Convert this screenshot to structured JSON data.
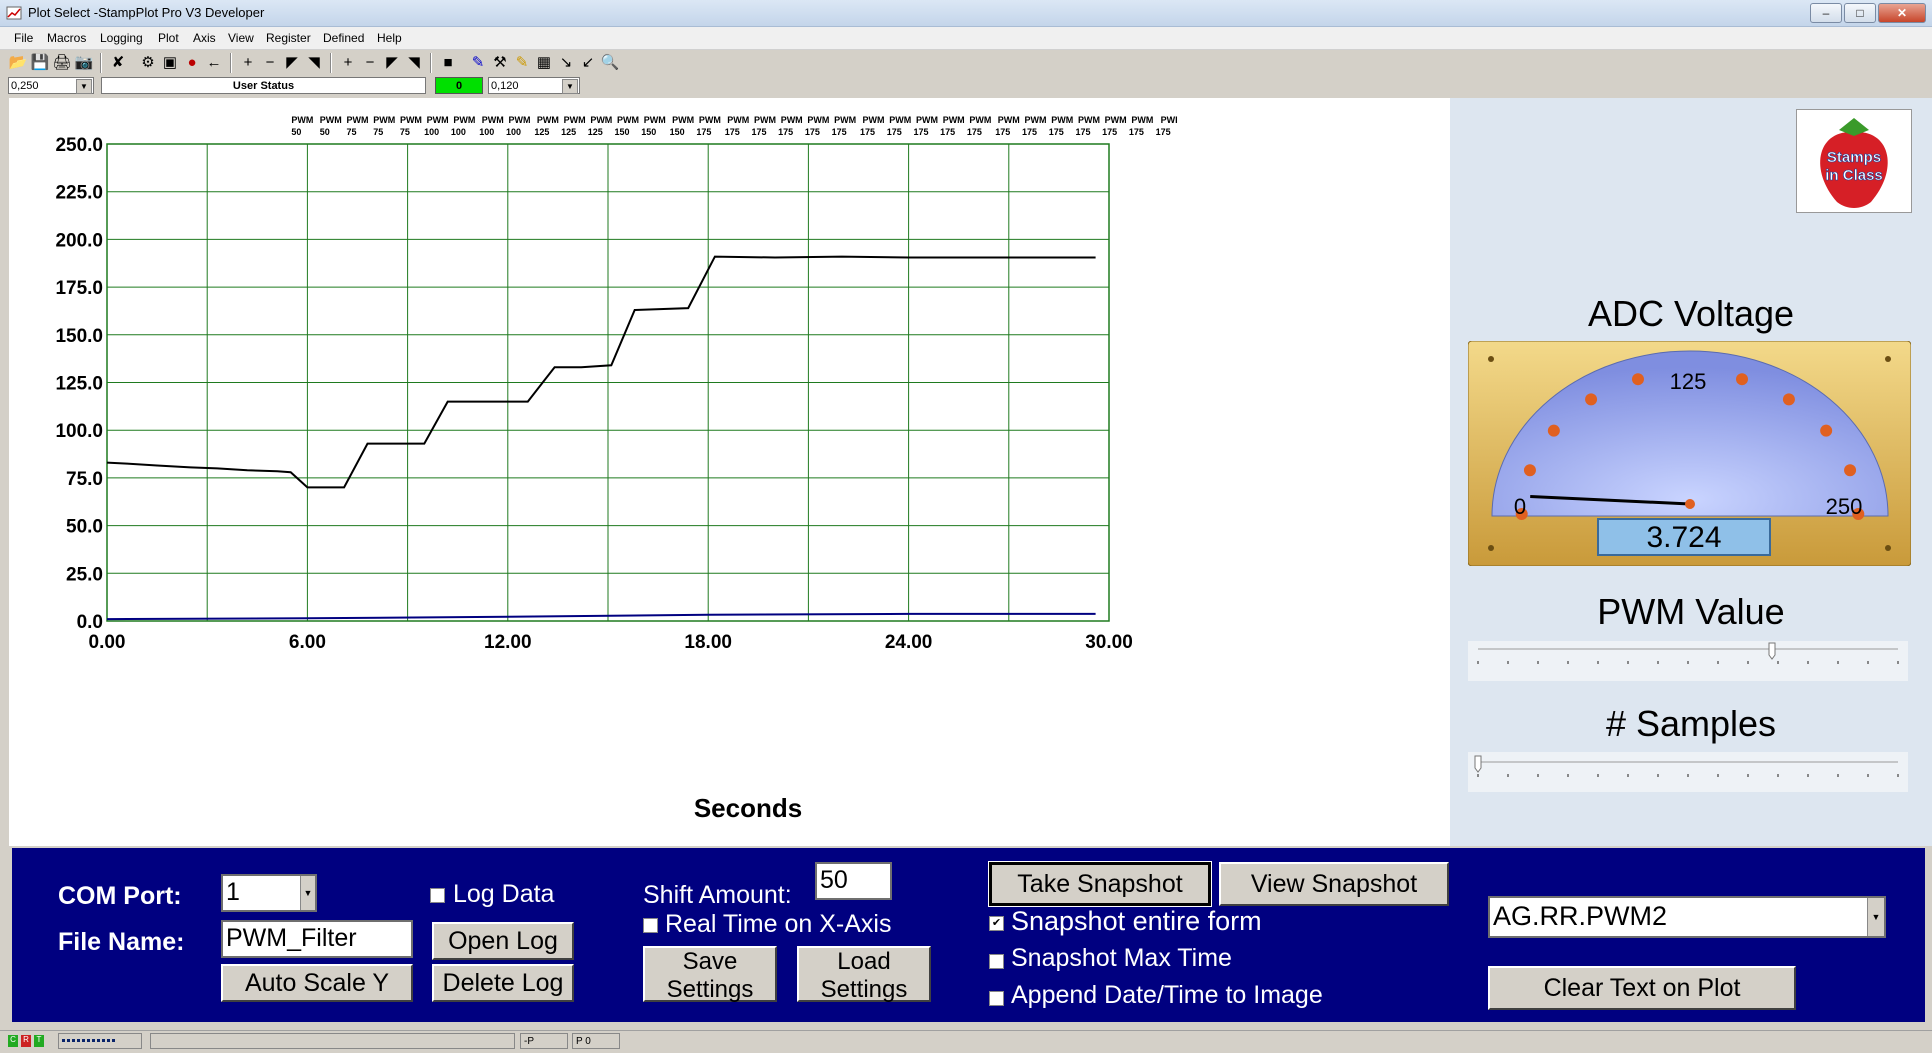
{
  "window": {
    "title": "Plot Select -StampPlot Pro V3 Developer"
  },
  "menu": [
    "File",
    "Macros",
    "Logging",
    "Plot",
    "Axis",
    "View",
    "Register",
    "Defined",
    "Help"
  ],
  "status_row": {
    "left_value": "0,250",
    "user_status": "User Status",
    "counter": "0",
    "right_value": "0,120"
  },
  "chart_data": {
    "type": "line",
    "xlabel": "Seconds",
    "ylabel": "",
    "xlim": [
      0,
      30
    ],
    "ylim": [
      0,
      250
    ],
    "x_ticks": [
      "0.00",
      "6.00",
      "12.00",
      "18.00",
      "24.00",
      "30.00"
    ],
    "y_ticks": [
      "250.0",
      "225.0",
      "200.0",
      "175.0",
      "150.0",
      "125.0",
      "100.0",
      "75.0",
      "50.0",
      "25.0",
      "0.0"
    ],
    "grid": true,
    "series": [
      {
        "color": "#000000",
        "x": [
          0,
          0.6,
          1.5,
          2.5,
          3.3,
          4.2,
          5.1,
          5.5,
          6.0,
          7.1,
          7.8,
          9.5,
          10.2,
          11.8,
          12.6,
          13.4,
          14.2,
          15.1,
          15.8,
          17.4,
          18.2,
          20,
          22,
          24,
          26,
          28,
          29.6
        ],
        "y": [
          83,
          82.5,
          81.5,
          80.5,
          80,
          79,
          78.5,
          78,
          70,
          70,
          93,
          93,
          115,
          115,
          115,
          133,
          133,
          134,
          163,
          164,
          191,
          190.5,
          191,
          190.5,
          190.5,
          190.5,
          190.5
        ]
      },
      {
        "color": "#000080",
        "x": [
          0,
          6,
          12,
          18,
          24,
          29.6
        ],
        "y": [
          1,
          1.4,
          2.2,
          3.3,
          3.7,
          3.7
        ]
      }
    ]
  },
  "annotations": [
    {
      "t": "PWM",
      "v": "50",
      "x": 5.85
    },
    {
      "t": "PWM",
      "v": "50",
      "x": 6.7
    },
    {
      "t": "PWM",
      "v": "75",
      "x": 7.5
    },
    {
      "t": "PWM",
      "v": "75",
      "x": 8.3
    },
    {
      "t": "PWM",
      "v": "75",
      "x": 9.1
    },
    {
      "t": "PWM",
      "v": "100",
      "x": 9.9
    },
    {
      "t": "PWM",
      "v": "100",
      "x": 10.7
    },
    {
      "t": "PWM",
      "v": "100",
      "x": 11.55
    },
    {
      "t": "PWM",
      "v": "100",
      "x": 12.35
    },
    {
      "t": "PWM",
      "v": "125",
      "x": 13.2
    },
    {
      "t": "PWM",
      "v": "125",
      "x": 14.0
    },
    {
      "t": "PWM",
      "v": "125",
      "x": 14.8
    },
    {
      "t": "PWM",
      "v": "150",
      "x": 15.6
    },
    {
      "t": "PWM",
      "v": "150",
      "x": 16.4
    },
    {
      "t": "PWM",
      "v": "150",
      "x": 17.25
    },
    {
      "t": "PWM",
      "v": "175",
      "x": 18.05
    },
    {
      "t": "PWM",
      "v": "175",
      "x": 18.9
    },
    {
      "t": "PWM",
      "v": "175",
      "x": 19.7
    },
    {
      "t": "PWM",
      "v": "175",
      "x": 20.5
    },
    {
      "t": "PWM",
      "v": "175",
      "x": 21.3
    },
    {
      "t": "PWM",
      "v": "175",
      "x": 22.1
    },
    {
      "t": "PWM",
      "v": "175",
      "x": 22.95
    },
    {
      "t": "PWM",
      "v": "175",
      "x": 23.75
    },
    {
      "t": "PWM",
      "v": "175",
      "x": 24.55
    },
    {
      "t": "PWM",
      "v": "175",
      "x": 25.35
    },
    {
      "t": "PWM",
      "v": "175",
      "x": 26.15
    },
    {
      "t": "PWM",
      "v": "175",
      "x": 27.0
    },
    {
      "t": "PWM",
      "v": "175",
      "x": 27.8
    },
    {
      "t": "PWM",
      "v": "175",
      "x": 28.6
    },
    {
      "t": "PWM",
      "v": "175",
      "x": 29.4
    },
    {
      "t": "PWM",
      "v": "175",
      "x": 30.2
    },
    {
      "t": "PWM",
      "v": "175",
      "x": 31.0
    },
    {
      "t": "PWI",
      "v": "175",
      "x": 31.8
    }
  ],
  "right_panel": {
    "logo_text": [
      "Stamps",
      "in Class"
    ],
    "adc_title": "ADC Voltage",
    "gauge": {
      "min": "0",
      "mid": "125",
      "max": "250",
      "readout": "3.724",
      "needle_value": 3.724,
      "scale_max": 250
    },
    "pwm_title": "PWM Value",
    "pwm_level": 0.7,
    "samples_title": "# Samples",
    "samples_level": 0.0
  },
  "controls": {
    "com_port_label": "COM Port:",
    "com_port_value": "1",
    "file_name_label": "File Name:",
    "file_name_value": "PWM_Filter",
    "auto_scale": "Auto Scale Y",
    "log_data": "Log Data",
    "open_log": "Open Log",
    "delete_log": "Delete Log",
    "shift_amount_label": "Shift Amount:",
    "shift_amount_value": "50",
    "real_time": "Real Time on X-Axis",
    "save_settings": [
      "Save",
      "Settings"
    ],
    "load_settings": [
      "Load",
      "Settings"
    ],
    "take_snapshot": "Take Snapshot",
    "view_snapshot": "View Snapshot",
    "snapshot_form": "Snapshot entire form",
    "snapshot_form_checked": "✔",
    "snapshot_max": "Snapshot Max Time",
    "append_date": "Append Date/Time to Image",
    "dropdown_value": "AG.RR.PWM2",
    "clear_text": "Clear Text on Plot"
  },
  "statusbar": {
    "p": "-P",
    "p0": "P 0"
  }
}
